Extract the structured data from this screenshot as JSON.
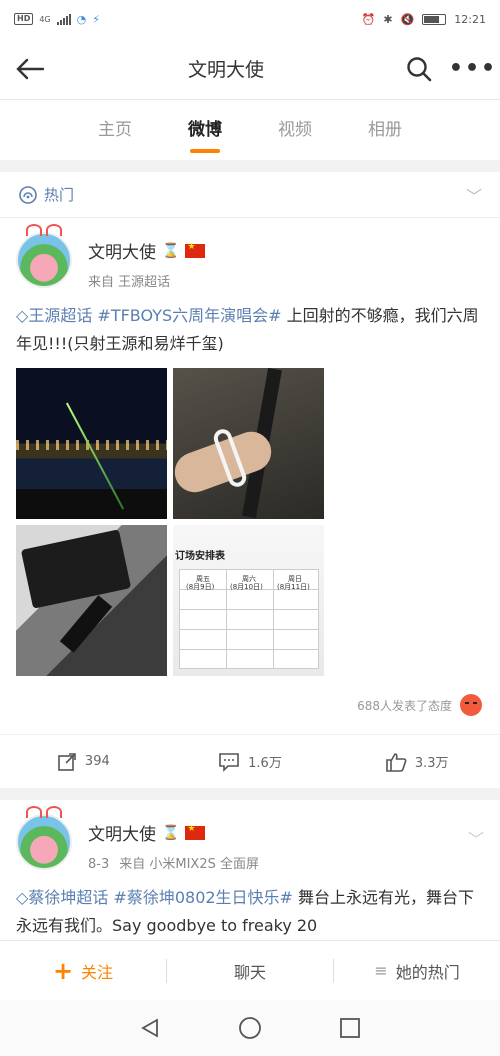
{
  "status_bar": {
    "hd": "HD",
    "network": "4G",
    "time": "12:21"
  },
  "header": {
    "title": "文明大使"
  },
  "tabs": [
    {
      "label": "主页"
    },
    {
      "label": "微博",
      "active": true
    },
    {
      "label": "视频"
    },
    {
      "label": "相册"
    }
  ],
  "hot_bar": {
    "label": "热门"
  },
  "post1": {
    "user_name": "文明大使",
    "source": "来自 王源超话",
    "topic": "王源超话",
    "hashtag": "#TFBOYS六周年演唱会#",
    "text": " 上回射的不够瘾，我们六周年见!!!(只射王源和易烊千玺)",
    "image4_title": "订场安排表",
    "image4_cells": [
      "周五",
      "周六",
      "周日",
      "(8月9日)",
      "(8月10日)",
      "(8月11日)"
    ],
    "attitude_text": "688人发表了态度",
    "repost_count": "394",
    "comment_count": "1.6万",
    "like_count": "3.3万"
  },
  "post2": {
    "user_name": "文明大使",
    "date": "8-3",
    "source": "来自 小米MIX2S 全面屏",
    "topic": "蔡徐坤超话",
    "hashtag": "#蔡徐坤0802生日快乐#",
    "text": " 舞台上永远有光，舞台下永远有我们。Say goodbye to freaky 20"
  },
  "bottom_bar": {
    "follow_label": "关注",
    "chat_label": "聊天",
    "hot_label": "她的热门"
  },
  "colors": {
    "accent": "#ff8200",
    "link": "#5b7fb1"
  }
}
